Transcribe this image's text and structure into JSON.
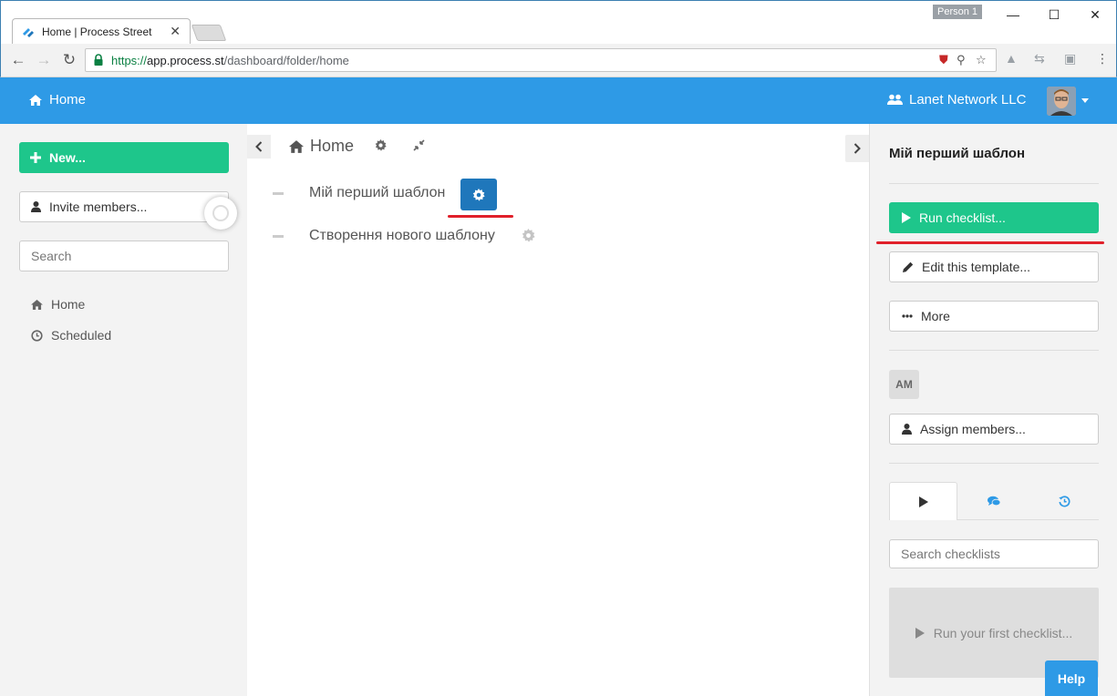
{
  "browser": {
    "tab_title": "Home | Process Street",
    "tab_close": "✕",
    "profile": "Person 1",
    "window_controls": {
      "minimize": "—",
      "maximize": "☐",
      "close": "✕"
    },
    "url_scheme": "https://",
    "url_host": "app.process.st",
    "url_path": "/dashboard/folder/home"
  },
  "header": {
    "home_label": "Home",
    "org_name": "Lanet Network LLC"
  },
  "sidebar": {
    "new_label": "New...",
    "invite_label": "Invite members...",
    "search_placeholder": "Search",
    "nav": [
      {
        "label": "Home",
        "icon": "home-icon"
      },
      {
        "label": "Scheduled",
        "icon": "clock-icon"
      }
    ]
  },
  "main": {
    "breadcrumb": "Home",
    "items": [
      {
        "name": "Мій перший шаблон"
      },
      {
        "name": "Створення нового шаблону"
      }
    ]
  },
  "panel": {
    "title": "Мій перший шаблон",
    "run_label": "Run checklist...",
    "edit_label": "Edit this template...",
    "more_label": "More",
    "member_initials": "AM",
    "assign_label": "Assign members...",
    "search_placeholder": "Search checklists",
    "empty_text": "Run your first checklist..."
  },
  "help_label": "Help",
  "colors": {
    "header_blue": "#2e9ae6",
    "green": "#1ec68b",
    "gear_blue": "#1f77bb",
    "annotation_red": "#e0202a"
  }
}
